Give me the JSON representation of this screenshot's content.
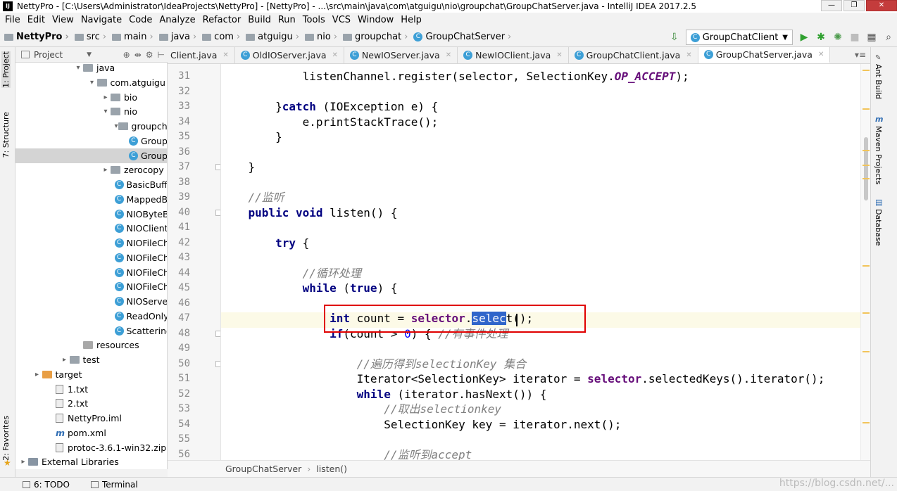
{
  "window": {
    "title": "NettyPro - [C:\\Users\\Administrator\\IdeaProjects\\NettyPro] - [NettyPro] - ...\\src\\main\\java\\com\\atguigu\\nio\\groupchat\\GroupChatServer.java - IntelliJ IDEA 2017.2.5"
  },
  "menu": [
    "File",
    "Edit",
    "View",
    "Navigate",
    "Code",
    "Analyze",
    "Refactor",
    "Build",
    "Run",
    "Tools",
    "VCS",
    "Window",
    "Help"
  ],
  "nav": {
    "crumbs": [
      "NettyPro",
      "src",
      "main",
      "java",
      "com",
      "atguigu",
      "nio",
      "groupchat",
      "GroupChatServer"
    ],
    "run_config": "GroupChatClient"
  },
  "left_strip": {
    "project": "1: Project",
    "structure": "7: Structure",
    "favorites": "2: Favorites"
  },
  "right_strip": {
    "ant": "Ant Build",
    "maven": "Maven Projects",
    "database": "Database"
  },
  "project_panel": {
    "title": "Project",
    "tree": [
      {
        "label": "java",
        "arrow": "▾",
        "icon": "folder",
        "depth": 4
      },
      {
        "label": "com.atguigu",
        "arrow": "▾",
        "icon": "folder",
        "depth": 5
      },
      {
        "label": "bio",
        "arrow": "▸",
        "icon": "folder",
        "depth": 6
      },
      {
        "label": "nio",
        "arrow": "▾",
        "icon": "folder",
        "depth": 6
      },
      {
        "label": "groupchat",
        "arrow": "▾",
        "icon": "folder",
        "depth": 7
      },
      {
        "label": "Group",
        "arrow": "",
        "icon": "class",
        "depth": 8
      },
      {
        "label": "Group",
        "arrow": "",
        "icon": "class",
        "depth": 8,
        "selected": true
      },
      {
        "label": "zerocopy",
        "arrow": "▸",
        "icon": "folder",
        "depth": 6
      },
      {
        "label": "BasicBuffe",
        "arrow": "",
        "icon": "class",
        "depth": 7
      },
      {
        "label": "MappedB",
        "arrow": "",
        "icon": "class",
        "depth": 7
      },
      {
        "label": "NIOByteB",
        "arrow": "",
        "icon": "class",
        "depth": 7
      },
      {
        "label": "NIOClient",
        "arrow": "",
        "icon": "class",
        "depth": 7
      },
      {
        "label": "NIOFileCh",
        "arrow": "",
        "icon": "class",
        "depth": 7
      },
      {
        "label": "NIOFileCh",
        "arrow": "",
        "icon": "class",
        "depth": 7
      },
      {
        "label": "NIOFileCh",
        "arrow": "",
        "icon": "class",
        "depth": 7
      },
      {
        "label": "NIOFileCh",
        "arrow": "",
        "icon": "class",
        "depth": 7
      },
      {
        "label": "NIOServer",
        "arrow": "",
        "icon": "class",
        "depth": 7
      },
      {
        "label": "ReadOnly",
        "arrow": "",
        "icon": "class",
        "depth": 7
      },
      {
        "label": "Scattering",
        "arrow": "",
        "icon": "class",
        "depth": 7
      },
      {
        "label": "resources",
        "arrow": "",
        "icon": "resfolder",
        "depth": 4
      },
      {
        "label": "test",
        "arrow": "▸",
        "icon": "folder",
        "depth": 3
      },
      {
        "label": "target",
        "arrow": "▸",
        "icon": "orangefolder",
        "depth": 1
      },
      {
        "label": "1.txt",
        "arrow": "",
        "icon": "file",
        "depth": 2
      },
      {
        "label": "2.txt",
        "arrow": "",
        "icon": "file",
        "depth": 2
      },
      {
        "label": "NettyPro.iml",
        "arrow": "",
        "icon": "file",
        "depth": 2
      },
      {
        "label": "pom.xml",
        "arrow": "",
        "icon": "maven",
        "depth": 2
      },
      {
        "label": "protoc-3.6.1-win32.zip",
        "arrow": "",
        "icon": "file",
        "depth": 2
      },
      {
        "label": "External Libraries",
        "arrow": "▸",
        "icon": "lib",
        "depth": 0
      }
    ]
  },
  "tabs": [
    {
      "label": "Client.java",
      "active": false
    },
    {
      "label": "OldIOServer.java",
      "active": false
    },
    {
      "label": "NewIOServer.java",
      "active": false
    },
    {
      "label": "NewIOClient.java",
      "active": false
    },
    {
      "label": "GroupChatClient.java",
      "active": false
    },
    {
      "label": "GroupChatServer.java",
      "active": true
    }
  ],
  "editor": {
    "line_numbers": [
      "31",
      "32",
      "33",
      "34",
      "35",
      "36",
      "37",
      "38",
      "39",
      "40",
      "41",
      "42",
      "43",
      "44",
      "45",
      "46",
      "47",
      "48",
      "49",
      "50",
      "51",
      "52",
      "53",
      "54",
      "55",
      "56"
    ],
    "lines": [
      [
        {
          "t": "            listenChannel.register(selector, SelectionKey.",
          "c": ""
        },
        {
          "t": "OP_ACCEPT",
          "c": "cn"
        },
        {
          "t": ");",
          "c": ""
        }
      ],
      [],
      [
        {
          "t": "        }",
          "c": ""
        },
        {
          "t": "catch",
          "c": "kw"
        },
        {
          "t": " (IOException e) {",
          "c": ""
        }
      ],
      [
        {
          "t": "            e.printStackTrace();",
          "c": ""
        }
      ],
      [
        {
          "t": "        }",
          "c": ""
        }
      ],
      [],
      [
        {
          "t": "    }",
          "c": ""
        }
      ],
      [],
      [
        {
          "t": "    //监听",
          "c": "cm"
        }
      ],
      [
        {
          "t": "    ",
          "c": ""
        },
        {
          "t": "public void",
          "c": "kw"
        },
        {
          "t": " listen() {",
          "c": ""
        }
      ],
      [],
      [
        {
          "t": "        ",
          "c": ""
        },
        {
          "t": "try",
          "c": "kw"
        },
        {
          "t": " {",
          "c": ""
        }
      ],
      [],
      [
        {
          "t": "            //循环处理",
          "c": "cm"
        }
      ],
      [
        {
          "t": "            ",
          "c": ""
        },
        {
          "t": "while",
          "c": "kw"
        },
        {
          "t": " (",
          "c": ""
        },
        {
          "t": "true",
          "c": "kw"
        },
        {
          "t": ") {",
          "c": ""
        }
      ],
      [],
      [
        {
          "t": "                ",
          "c": ""
        },
        {
          "t": "int",
          "c": "kw"
        },
        {
          "t": " count = ",
          "c": ""
        },
        {
          "t": "selector",
          "c": "sl"
        },
        {
          "t": ".",
          "c": ""
        },
        {
          "t": "selec",
          "c": "selword"
        },
        {
          "t": "t();",
          "c": ""
        }
      ],
      [
        {
          "t": "                ",
          "c": ""
        },
        {
          "t": "if",
          "c": "kw"
        },
        {
          "t": "(count > ",
          "c": ""
        },
        {
          "t": "0",
          "c": "num"
        },
        {
          "t": ") { ",
          "c": ""
        },
        {
          "t": "//有事件处理",
          "c": "cm"
        }
      ],
      [],
      [
        {
          "t": "                    //遍历得到selectionKey 集合",
          "c": "cm"
        }
      ],
      [
        {
          "t": "                    Iterator<SelectionKey> iterator = ",
          "c": ""
        },
        {
          "t": "selector",
          "c": "sl"
        },
        {
          "t": ".selectedKeys().iterator();",
          "c": ""
        }
      ],
      [
        {
          "t": "                    ",
          "c": ""
        },
        {
          "t": "while",
          "c": "kw"
        },
        {
          "t": " (iterator.hasNext()) {",
          "c": ""
        }
      ],
      [
        {
          "t": "                        //取出selectionkey",
          "c": "cm"
        }
      ],
      [
        {
          "t": "                        SelectionKey key = iterator.next();",
          "c": ""
        }
      ],
      [],
      [
        {
          "t": "                        //监听到accept",
          "c": "cm"
        }
      ]
    ]
  },
  "breadcrumb": [
    "GroupChatServer",
    "listen()"
  ],
  "statusbar": {
    "todo": "6: TODO",
    "terminal": "Terminal"
  },
  "watermark": "https://blog.csdn.net/..."
}
